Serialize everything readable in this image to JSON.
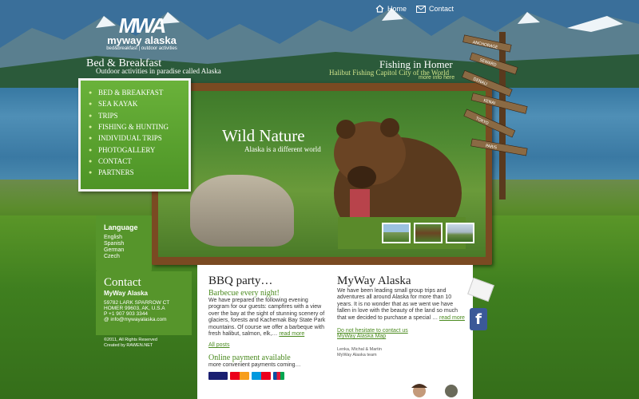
{
  "topnav": {
    "home": "Home",
    "contact": "Contact"
  },
  "logo": {
    "mark": "MWA",
    "name": "myway alaska",
    "tag": "bed&breakfast | outdoor activities"
  },
  "header": {
    "bb_title": "Bed & Breakfast",
    "bb_sub": "Outdoor activities in paradise called Alaska",
    "fish_title": "Fishing in Homer",
    "fish_sub": "Halibut Fishing Capitol City of the World",
    "fish_more": "more info here"
  },
  "menu": {
    "items": [
      "BED & BREAKFAST",
      "SEA KAYAK",
      "TRIPS",
      "FISHING & HUNTING",
      "INDIVIDUAL TRIPS",
      "PHOTOGALLERY",
      "CONTACT",
      "PARTNERS"
    ]
  },
  "slide": {
    "title": "Wild Nature",
    "sub": "Alaska is a different world"
  },
  "signpost": {
    "labels": [
      "ANCHORAGE",
      "SEWARD",
      "DENALI",
      "KENAI",
      "TOKYO",
      "PARIS"
    ]
  },
  "language": {
    "title": "Language",
    "items": [
      "English",
      "Spanish",
      "German",
      "Czech"
    ]
  },
  "contact": {
    "title": "Contact",
    "name": "MyWay Alaska",
    "address1": "59782 LARK SPARROW CT",
    "address2": "HOMER 99603, AK, U.S.A",
    "phone": "P +1 907 903 3344",
    "email": "@ info@mywayalaska.com"
  },
  "copyright": {
    "line1": "©2011, All Rights Reserved",
    "line2": "Created by RAWEN.NET"
  },
  "bbq": {
    "title": "BBQ party…",
    "subtitle": "Barbecue every night!",
    "body": "We have prepared the following evening program for our guests: campfires with a view over the bay at the sight of stunning scenery of glaciers, forests and Kachemak Bay State Park mountains. Of course we offer a barbeque with fresh halibut, salmon, elk,…",
    "read_more": "read more",
    "all_posts": "All posts",
    "payment_title": "Online payment available",
    "payment_sub": "more convenient payments coming…"
  },
  "about": {
    "title": "MyWay Alaska",
    "body": "We have been leading small group trips and adventures all around Alaska for more than 10 years.  It is no wonder that as we went we have fallen in love with the beauty of the land so much that we decided to purchase a special …",
    "read_more": "read more",
    "contact_link": "Do not hesitate to contact us",
    "map_link": "MyWay Alaska Map",
    "signature1": "Lenka, Michal & Martin",
    "signature2": "MyWay Alaska team"
  },
  "colors": {
    "green": "#56952b",
    "link_green": "#4a8a1e",
    "frame": "#7a4a22"
  }
}
